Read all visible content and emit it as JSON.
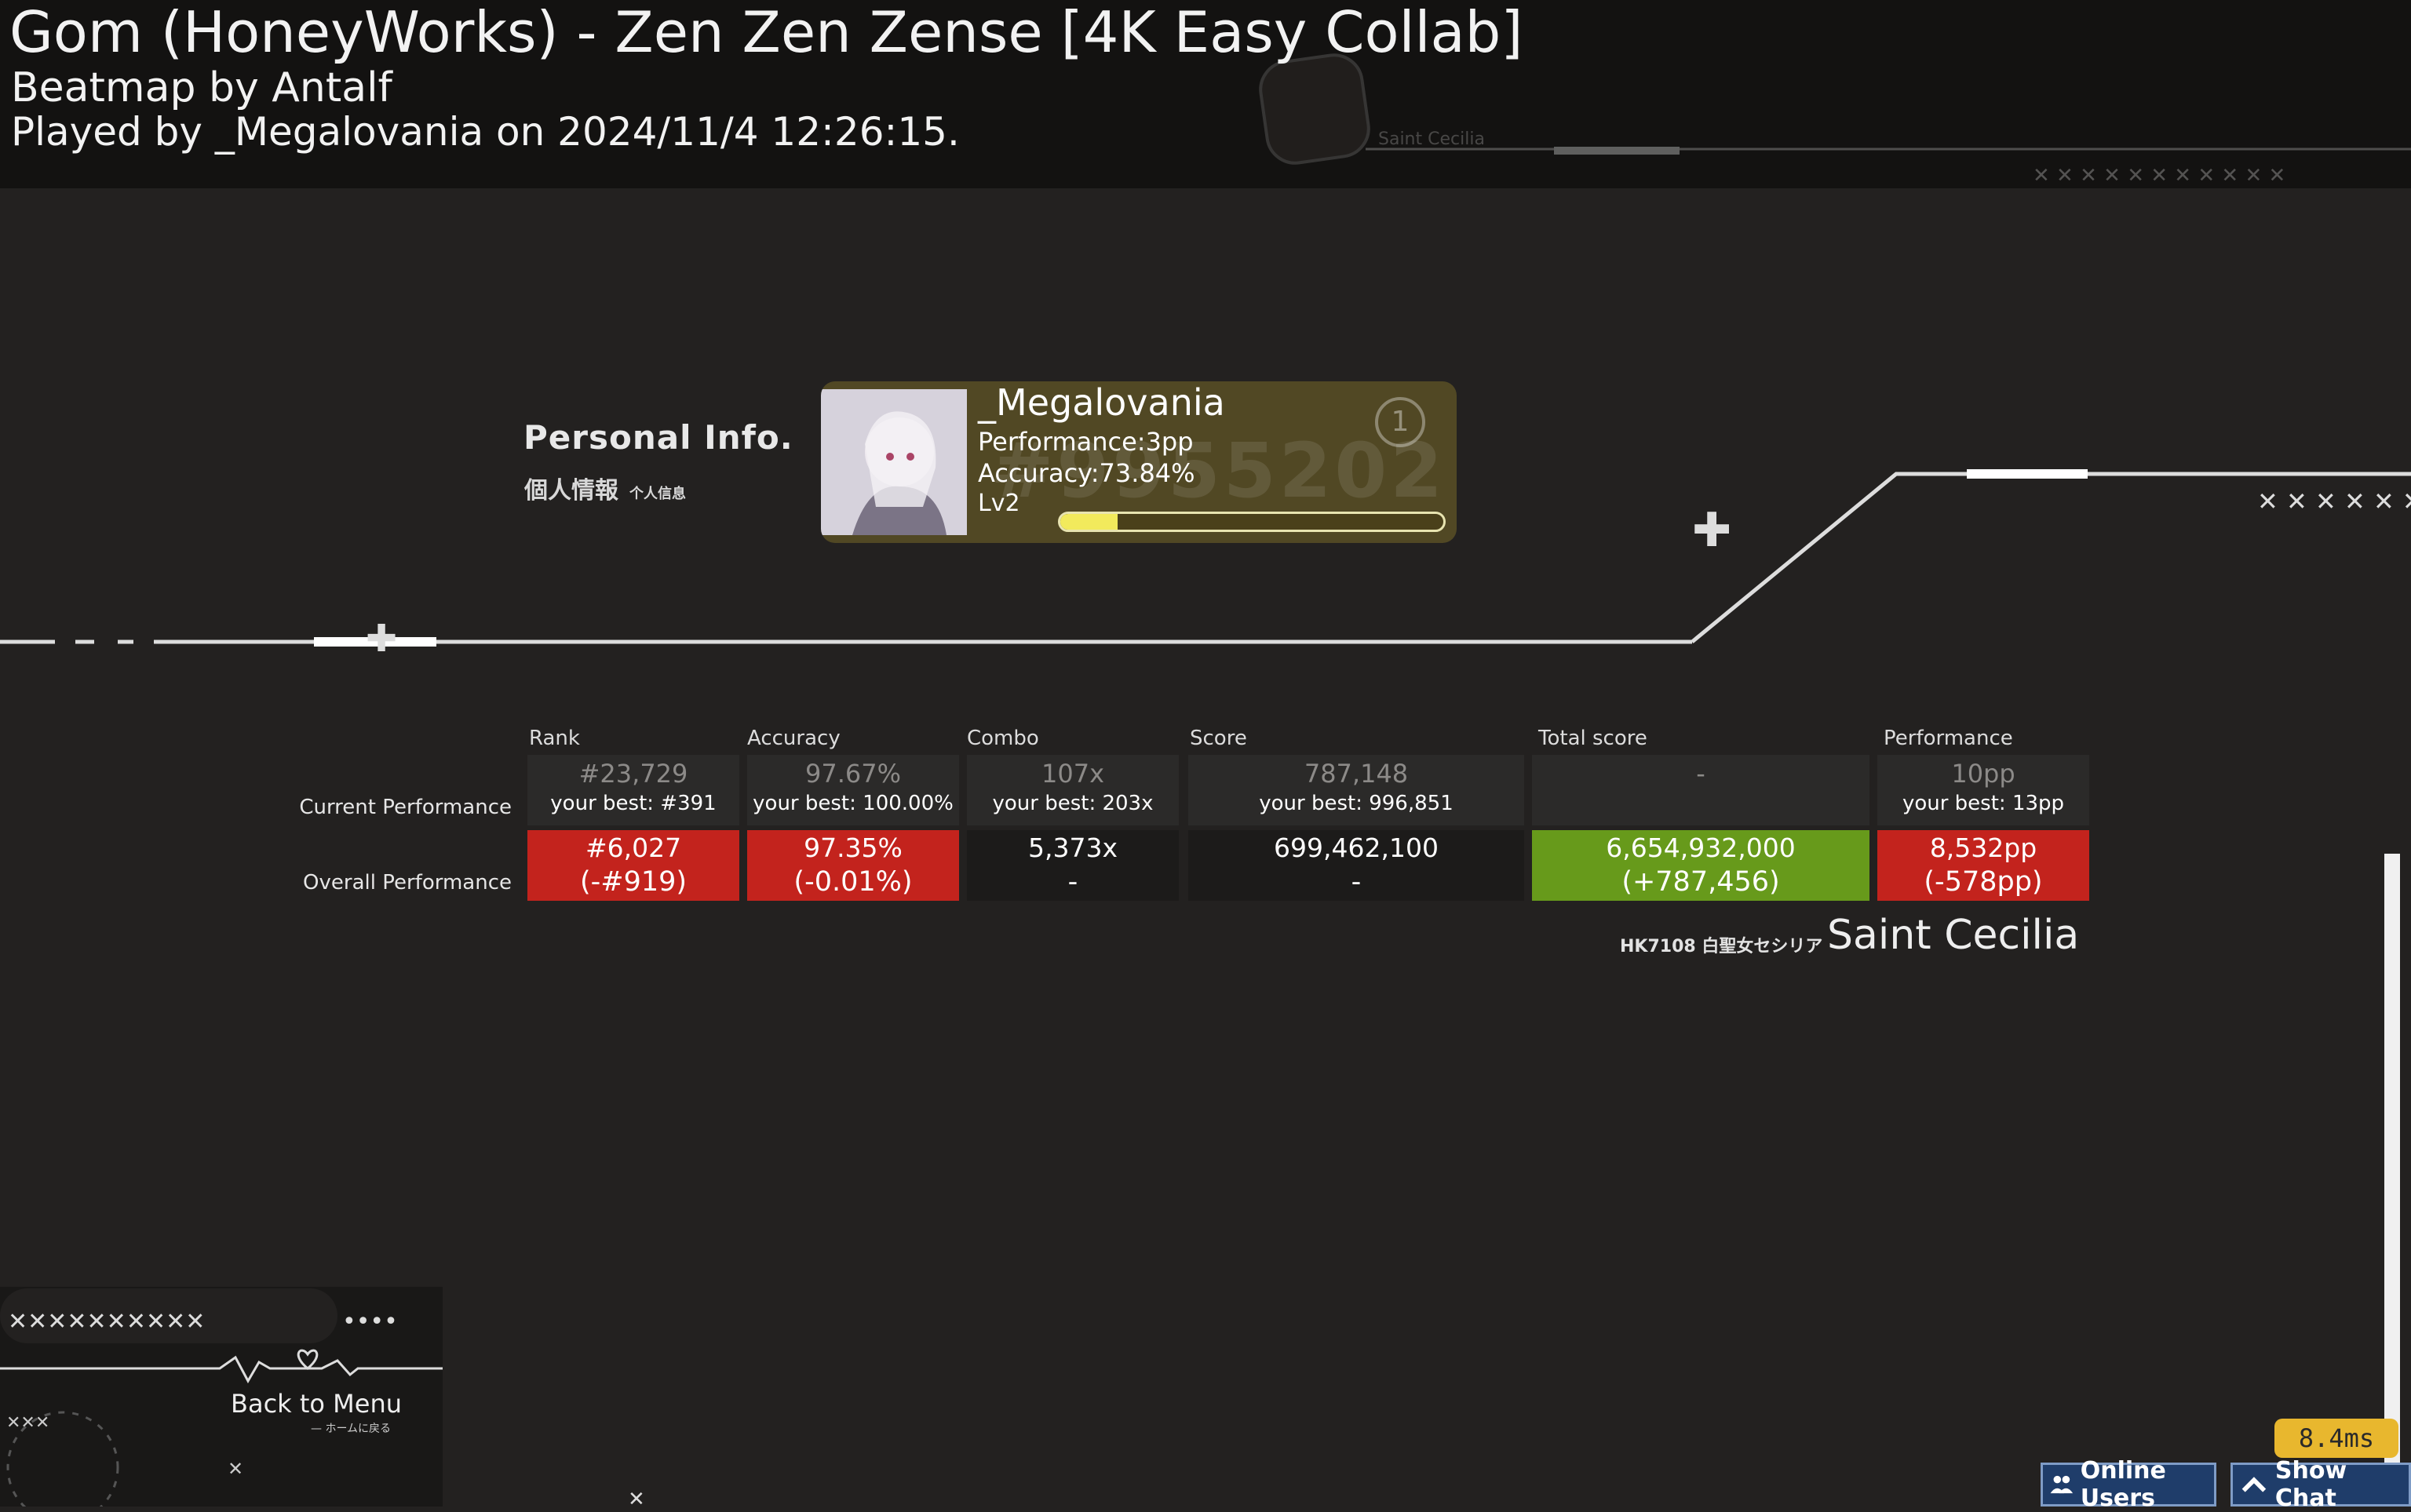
{
  "header": {
    "title": "Gom (HoneyWorks) - Zen Zen Zense [4K Easy Collab]",
    "mapper": "Beatmap by Antalf",
    "played": "Played by _Megalovania on 2024/11/4 12:26:15.",
    "bg_tag": "Saint Cecilia"
  },
  "personal_info": {
    "title": "Personal Info.",
    "subtitle_jp": "個人情報",
    "subtitle_small": "个人信息"
  },
  "user_card": {
    "name": "_Megalovania",
    "performance": "Performance:3pp",
    "accuracy": "Accuracy:73.84%",
    "level": "Lv2",
    "level_progress": 0.15,
    "bg_number": "#9955202",
    "badge": "1"
  },
  "stats": {
    "row_labels": {
      "current": "Current Performance",
      "overall": "Overall Performance"
    },
    "columns": [
      {
        "header": "Rank",
        "current": "#23,729",
        "current_best": "your best: #391",
        "overall": "#6,027",
        "overall_delta": "(-#919)",
        "status": "red"
      },
      {
        "header": "Accuracy",
        "current": "97.67%",
        "current_best": "your best: 100.00%",
        "overall": "97.35%",
        "overall_delta": "(-0.01%)",
        "status": "red"
      },
      {
        "header": "Combo",
        "current": "107x",
        "current_best": "your best: 203x",
        "overall": "5,373x",
        "overall_delta": "-",
        "status": "neutral"
      },
      {
        "header": "Score",
        "current": "787,148",
        "current_best": "your best: 996,851",
        "overall": "699,462,100",
        "overall_delta": "-",
        "status": "neutral"
      },
      {
        "header": "Total score",
        "current": "-",
        "current_best": "",
        "overall": "6,654,932,000",
        "overall_delta": "(+787,456)",
        "status": "green"
      },
      {
        "header": "Performance",
        "current": "10pp",
        "current_best": "your best: 13pp",
        "overall": "8,532pp",
        "overall_delta": "(-578pp)",
        "status": "red"
      }
    ],
    "colors": {
      "red": "#c3231d",
      "green": "#679a1b",
      "neutral": "#1c1b1a"
    }
  },
  "sponsor": {
    "small": "HK7108 白聖女セシリア",
    "big": "Saint Cecilia"
  },
  "back": {
    "label": "Back to Menu",
    "sub": "— ホームに戻る"
  },
  "latency": "8.4ms",
  "buttons": {
    "online_users": "Online Users",
    "show_chat": "Show Chat"
  },
  "icons": [
    "users-icon",
    "chevron-up-icon",
    "heart-icon",
    "plus-icon"
  ]
}
